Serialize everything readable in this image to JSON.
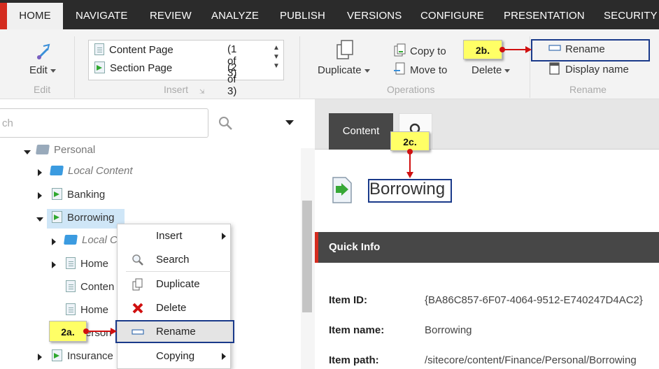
{
  "nav": {
    "tabs": [
      "HOME",
      "NAVIGATE",
      "REVIEW",
      "ANALYZE",
      "PUBLISH",
      "VERSIONS",
      "CONFIGURE",
      "PRESENTATION",
      "SECURITY"
    ],
    "active": "HOME"
  },
  "ribbon": {
    "edit": {
      "button": "Edit",
      "group": "Edit"
    },
    "insert": {
      "items": [
        {
          "label": "Content Page",
          "count": "(1 of 3)"
        },
        {
          "label": "Section Page",
          "count": "(2 of 3)"
        }
      ],
      "group": "Insert"
    },
    "operations": {
      "duplicate": "Duplicate",
      "copy_to": "Copy to",
      "move_to": "Move to",
      "delete": "Delete",
      "group": "Operations"
    },
    "rename": {
      "rename": "Rename",
      "display_name": "Display name",
      "group": "Rename"
    }
  },
  "callouts": {
    "a": "2a.",
    "b": "2b.",
    "c": "2c."
  },
  "search": {
    "placeholder": "ch"
  },
  "tree": {
    "personal": "Personal",
    "local_content": "Local Content",
    "banking": "Banking",
    "borrowing": "Borrowing",
    "local_content_child": "Local Co",
    "home_1": "Home",
    "content": "Conten",
    "home_2": "Home",
    "personal_child": "erson",
    "insurance": "Insurance"
  },
  "context_menu": {
    "insert": "Insert",
    "search": "Search",
    "duplicate": "Duplicate",
    "delete": "Delete",
    "rename": "Rename",
    "copying": "Copying"
  },
  "editor": {
    "tab_content": "Content",
    "item_title": "Borrowing",
    "quick_info": "Quick Info",
    "item_id_label": "Item ID:",
    "item_id": "{BA86C857-6F07-4064-9512-E740247D4AC2}",
    "item_name_label": "Item name:",
    "item_name": "Borrowing",
    "item_path_label": "Item path:",
    "item_path": "/sitecore/content/Finance/Personal/Borrowing"
  },
  "colors": {
    "accent_red": "#d42c1f",
    "callout_yellow": "#ffff66",
    "highlight_blue": "#1a3a8a"
  }
}
